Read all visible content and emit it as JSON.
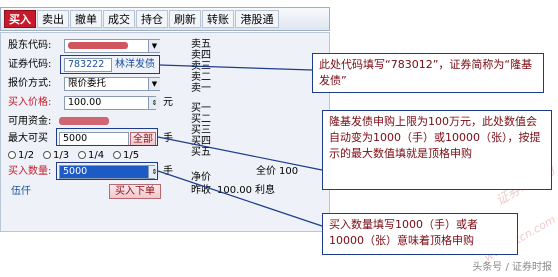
{
  "toolbar": {
    "tabs": [
      {
        "label": "买入",
        "active": true
      },
      {
        "label": "卖出"
      },
      {
        "label": "撤单"
      },
      {
        "label": "成交"
      },
      {
        "label": "持仓"
      },
      {
        "label": "刷新"
      },
      {
        "label": "转账"
      },
      {
        "label": "港股通"
      }
    ]
  },
  "form": {
    "account_label": "股东代码:",
    "code_label": "证券代码:",
    "code_value": "783222",
    "code_name": "林洋发债",
    "price_mode_label": "报价方式:",
    "price_mode_value": "限价委托",
    "price_label": "买入价格:",
    "price_value": "100.00",
    "price_unit": "元",
    "funds_label": "可用资金:",
    "max_label": "最大可买",
    "max_value": "5000",
    "all_button": "全部",
    "max_unit": "手",
    "radio_labels": [
      "1/2",
      "1/3",
      "1/4",
      "1/5"
    ],
    "qty_label": "买入数量:",
    "qty_value": "5000",
    "qty_unit": "手",
    "bottom_link": "伍仟",
    "buy_button": "买入下单"
  },
  "quotes": {
    "sells": [
      "卖五",
      "卖四",
      "卖三",
      "卖二",
      "卖一"
    ],
    "buys": [
      "买一",
      "买二",
      "买三",
      "买四",
      "买五"
    ],
    "net_label": "净价",
    "full_label": "全价",
    "full_value": "100",
    "close_label": "昨收",
    "close_value": "100.00",
    "interest_label": "利息"
  },
  "callouts": {
    "c1": "此处代码填写“783012”，证券简称为“隆基发债”",
    "c2": "隆基发债申购上限为100万元，此处数值会自动变为1000（手）或10000（张），按提示的最大数值填就是顶格申购",
    "c3": "买入数量填写1000（手）或者10000（张）意味着顶格申购"
  },
  "watermark": {
    "text1": "证券时报网",
    "text2": "www.stcn.com"
  },
  "credit": "头条号 / 证券时报"
}
